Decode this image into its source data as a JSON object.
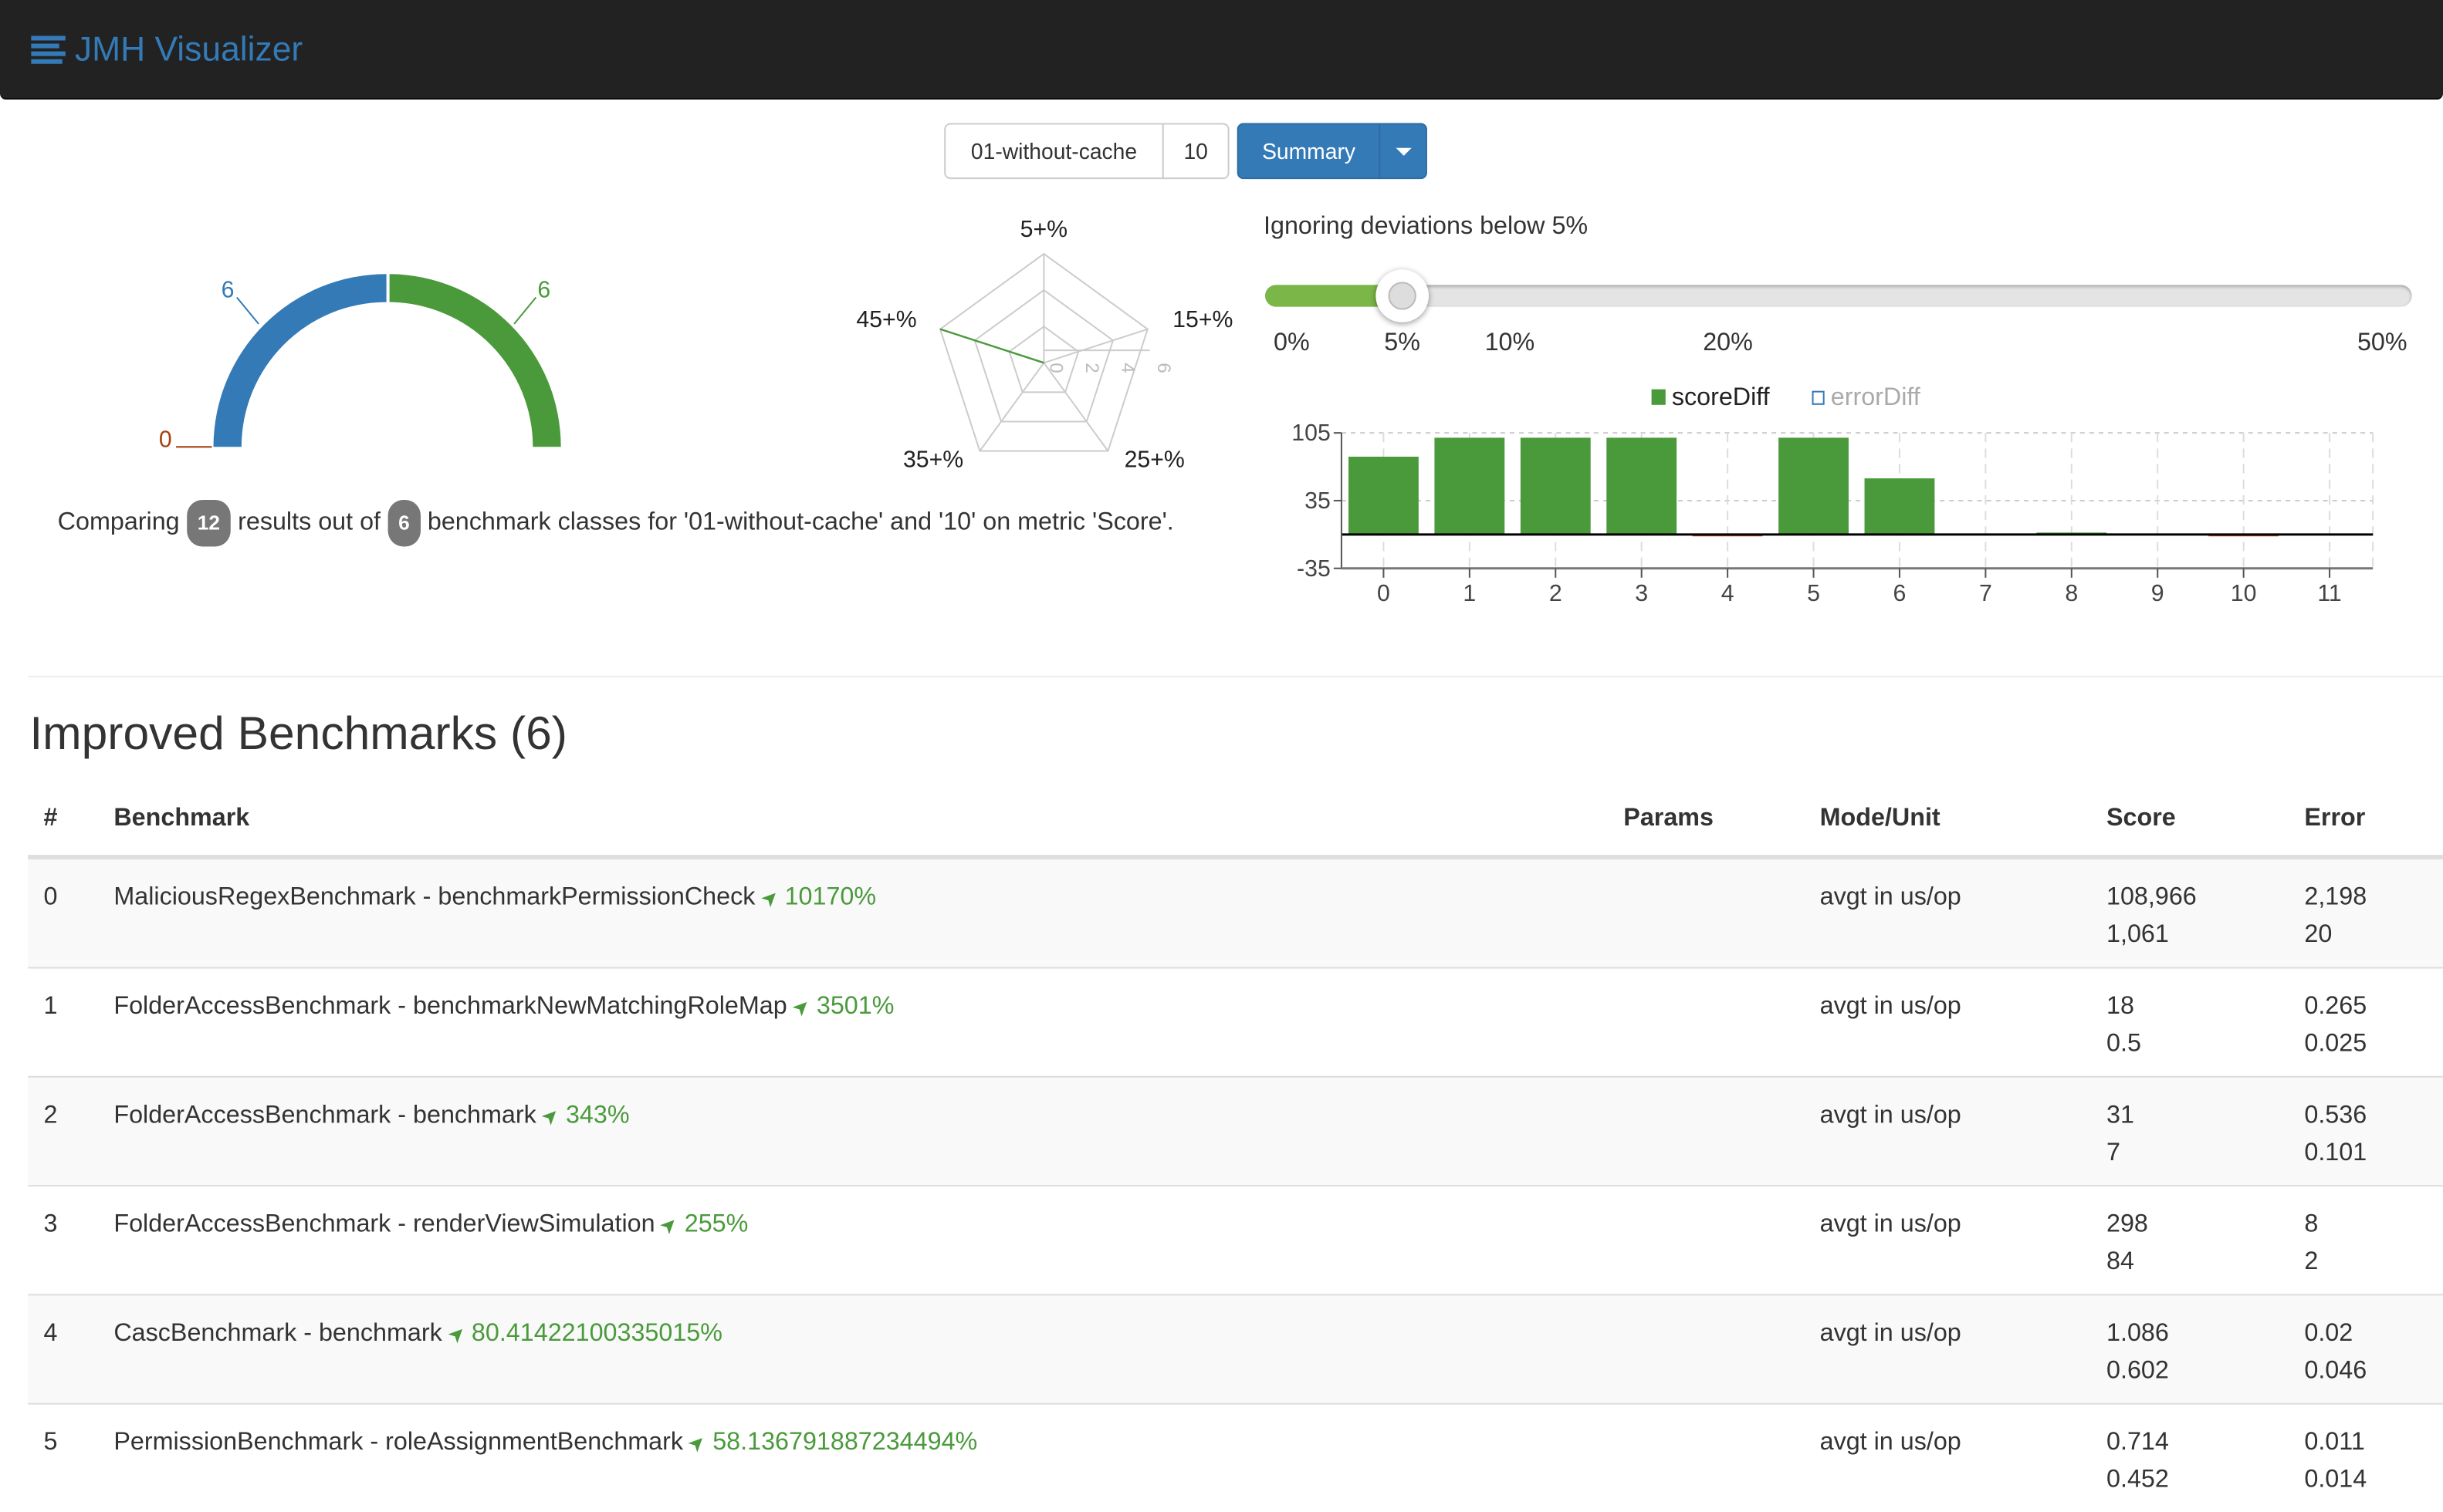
{
  "navbar": {
    "title": "JMH Visualizer",
    "icon": "list-icon"
  },
  "toolbar": {
    "run1": "01-without-cache",
    "run2": "10",
    "view_label": "Summary",
    "dropdown_icon": "caret-down-icon"
  },
  "gauge": {
    "left_value": "6",
    "right_value": "6",
    "zero_value": "0",
    "colors": {
      "left": "#337ab7",
      "right": "#4a9a3c",
      "zero": "#a94010"
    }
  },
  "radar": {
    "axes": [
      "5+%",
      "15+%",
      "25+%",
      "35+%",
      "45+%"
    ],
    "ticks": [
      "0",
      "2",
      "4",
      "6"
    ],
    "values": [
      0,
      0,
      0,
      0,
      6
    ],
    "max": 6
  },
  "summary": {
    "prefix": "Comparing",
    "results": "12",
    "middle": "results out of",
    "classes": "6",
    "suffix": "benchmark classes for '01-without-cache' and '10' on metric 'Score'."
  },
  "slider": {
    "label": "Ignoring deviations below 5%",
    "value_percent": 5,
    "ticks": [
      "0%",
      "5%",
      "10%",
      "20%",
      "50%"
    ]
  },
  "chart_data": {
    "type": "bar",
    "categories": [
      "0",
      "1",
      "2",
      "3",
      "4",
      "5",
      "6",
      "7",
      "8",
      "9",
      "10",
      "11"
    ],
    "series": [
      {
        "name": "scoreDiff",
        "values": [
          80.4,
          100,
          100,
          100,
          -1,
          100,
          58,
          0,
          2,
          0,
          -1,
          0
        ]
      }
    ],
    "legend": [
      "scoreDiff",
      "errorDiff"
    ],
    "yticks": [
      "105",
      "35",
      "-35"
    ],
    "ylim": [
      -35,
      105
    ],
    "grid": true,
    "legend_placement": "top",
    "colors": {
      "positive": "#4a9a3c",
      "negative": "#c0502a"
    }
  },
  "section": {
    "title": "Improved Benchmarks (6)"
  },
  "table": {
    "headers": [
      "#",
      "Benchmark",
      "Params",
      "Mode/Unit",
      "Score",
      "Error"
    ],
    "rows": [
      {
        "idx": "0",
        "name": "MaliciousRegexBenchmark - benchmarkPermissionCheck",
        "pct": "10170%",
        "params": "",
        "mode": "avgt in us/op",
        "score1": "108,966",
        "score2": "1,061",
        "err1": "2,198",
        "err2": "20"
      },
      {
        "idx": "1",
        "name": "FolderAccessBenchmark - benchmarkNewMatchingRoleMap",
        "pct": "3501%",
        "params": "",
        "mode": "avgt in us/op",
        "score1": "18",
        "score2": "0.5",
        "err1": "0.265",
        "err2": "0.025"
      },
      {
        "idx": "2",
        "name": "FolderAccessBenchmark - benchmark",
        "pct": "343%",
        "params": "",
        "mode": "avgt in us/op",
        "score1": "31",
        "score2": "7",
        "err1": "0.536",
        "err2": "0.101"
      },
      {
        "idx": "3",
        "name": "FolderAccessBenchmark - renderViewSimulation",
        "pct": "255%",
        "params": "",
        "mode": "avgt in us/op",
        "score1": "298",
        "score2": "84",
        "err1": "8",
        "err2": "2"
      },
      {
        "idx": "4",
        "name": "CascBenchmark - benchmark",
        "pct": "80.41422100335015%",
        "params": "",
        "mode": "avgt in us/op",
        "score1": "1.086",
        "score2": "0.602",
        "err1": "0.02",
        "err2": "0.046"
      },
      {
        "idx": "5",
        "name": "PermissionBenchmark - roleAssignmentBenchmark",
        "pct": "58.136791887234494%",
        "params": "",
        "mode": "avgt in us/op",
        "score1": "0.714",
        "score2": "0.452",
        "err1": "0.011",
        "err2": "0.014"
      }
    ]
  }
}
